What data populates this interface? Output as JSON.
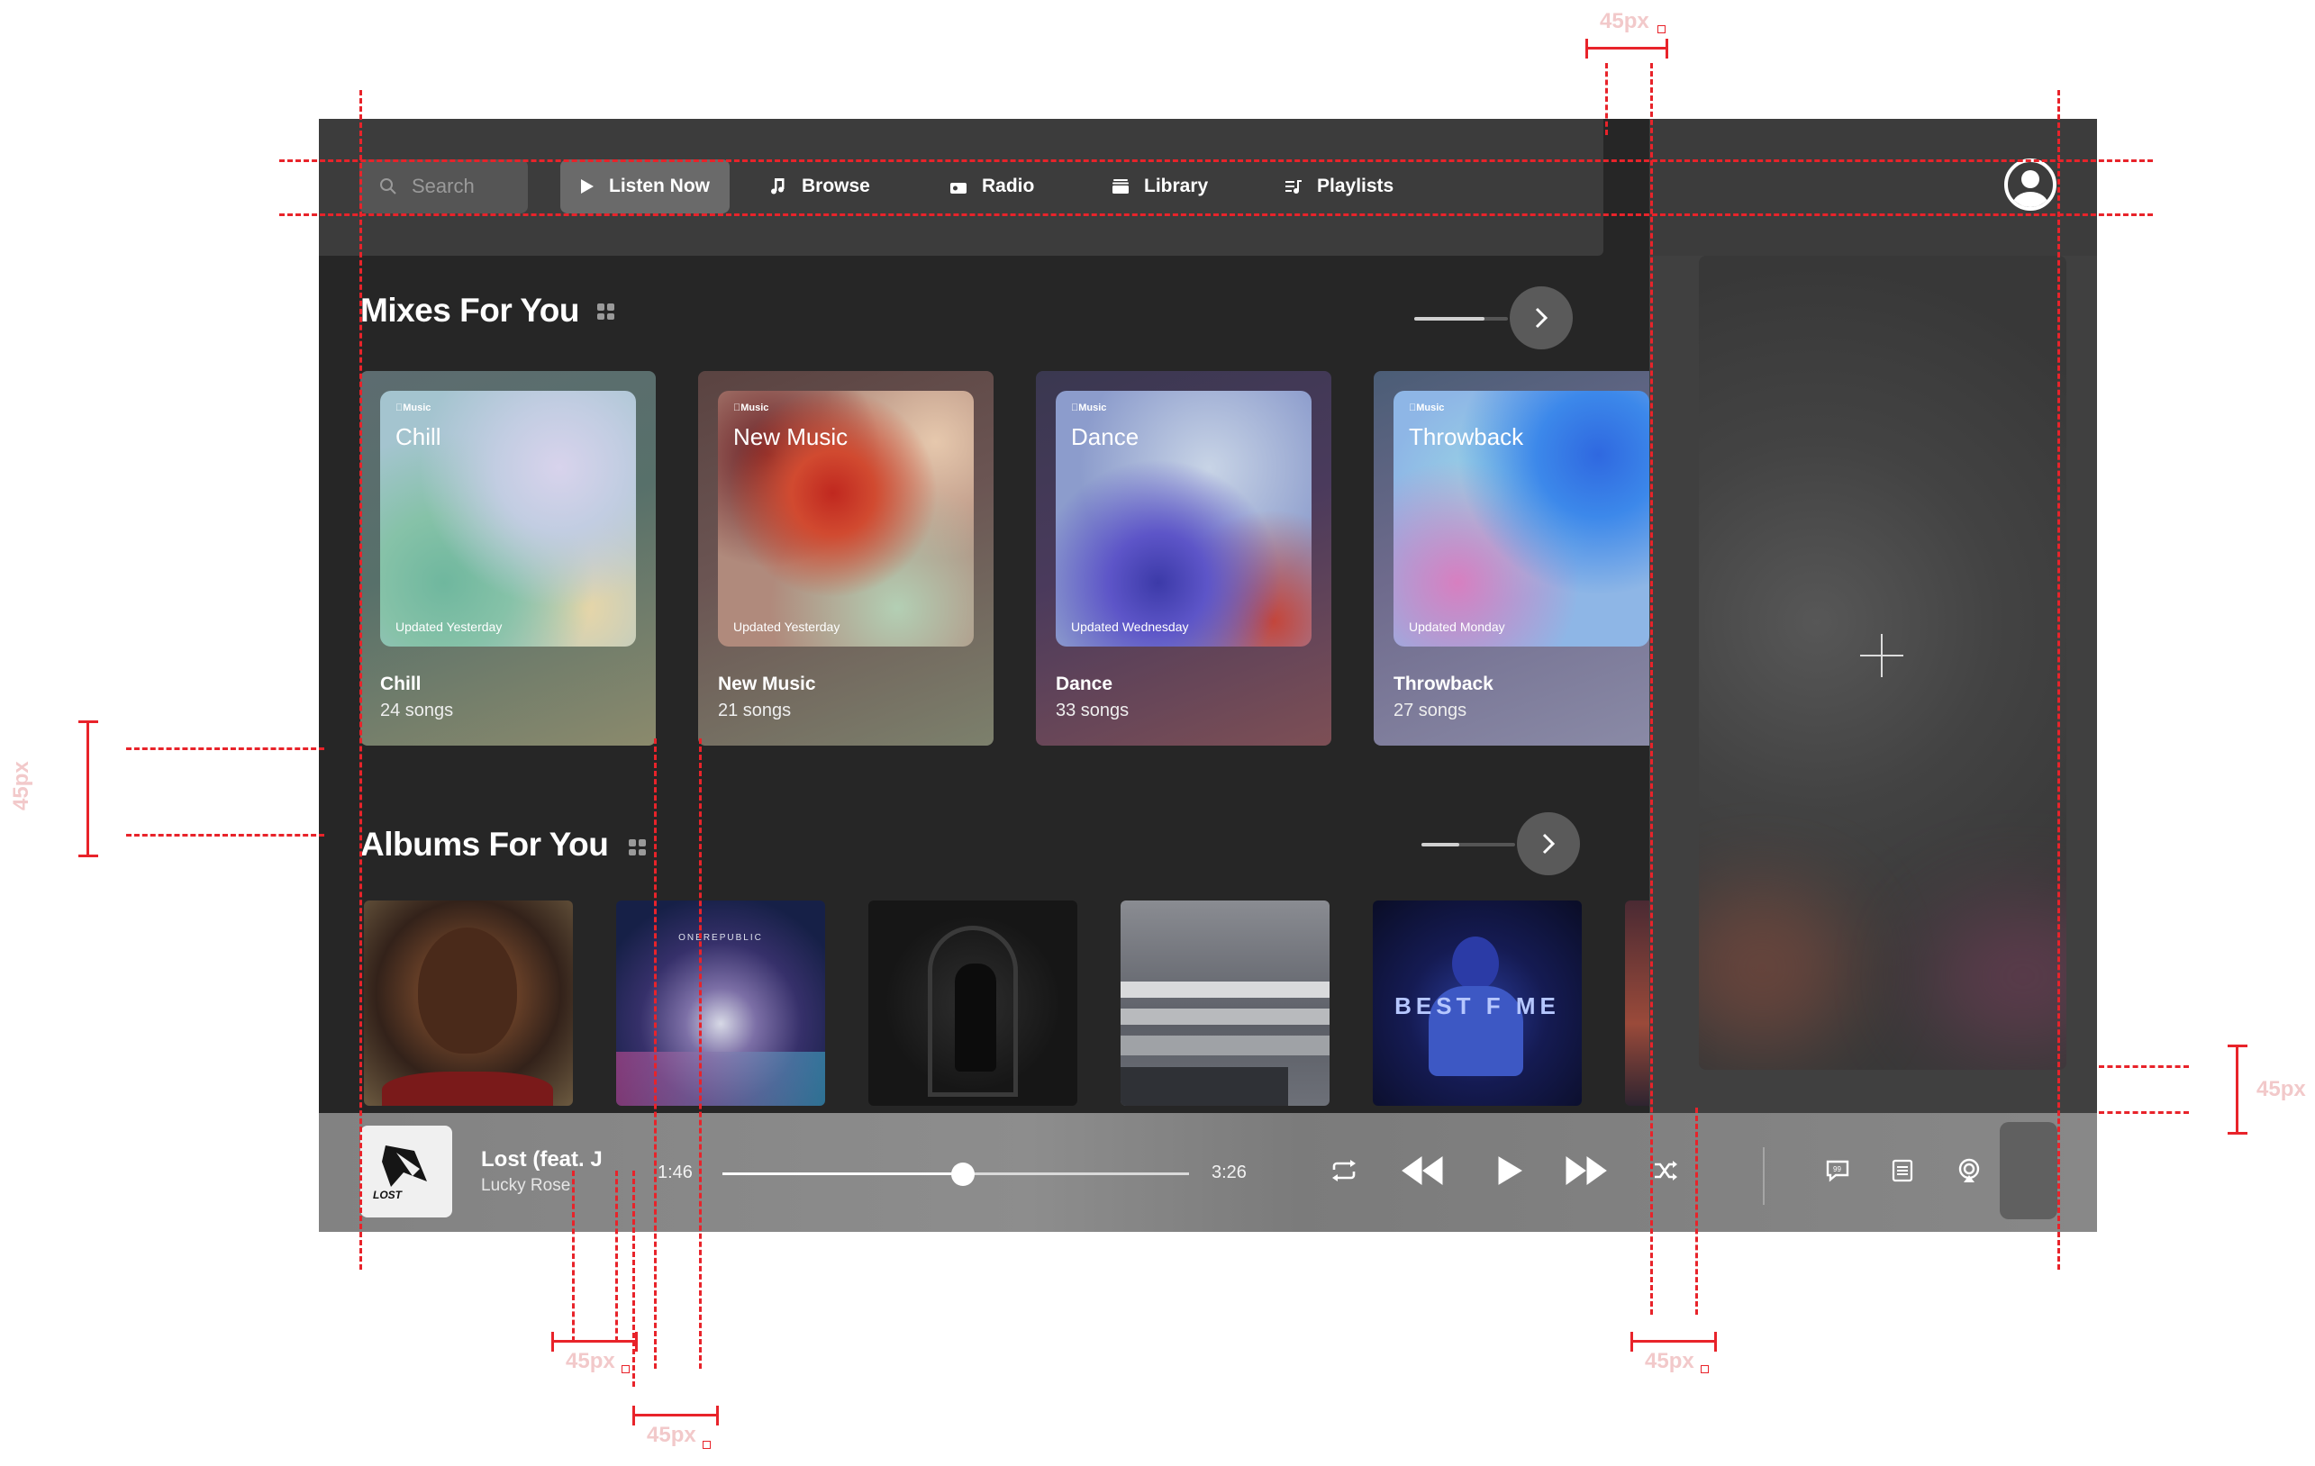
{
  "measurements": {
    "spacing_label": "45px"
  },
  "topbar": {
    "search": {
      "placeholder": "Search",
      "icon": "search-icon"
    },
    "nav": [
      {
        "label": "Listen Now",
        "icon": "play-icon",
        "active": true
      },
      {
        "label": "Browse",
        "icon": "music-note-icon",
        "active": false
      },
      {
        "label": "Radio",
        "icon": "radio-icon",
        "active": false
      },
      {
        "label": "Library",
        "icon": "library-icon",
        "active": false
      },
      {
        "label": "Playlists",
        "icon": "playlists-icon",
        "active": false
      }
    ],
    "profile_icon": "user-avatar-icon"
  },
  "mixes": {
    "title": "Mixes For You",
    "progress": 0.75,
    "cards": [
      {
        "brand": "Music",
        "art_title": "Chill",
        "updated": "Updated Yesterday",
        "name": "Chill",
        "count": "24 songs"
      },
      {
        "brand": "Music",
        "art_title": "New Music",
        "updated": "Updated Yesterday",
        "name": "New Music",
        "count": "21 songs"
      },
      {
        "brand": "Music",
        "art_title": "Dance",
        "updated": "Updated Wednesday",
        "name": "Dance",
        "count": "33 songs"
      },
      {
        "brand": "Music",
        "art_title": "Throwback",
        "updated": "Updated Monday",
        "name": "Throwback",
        "count": "27 songs"
      }
    ]
  },
  "albums": {
    "title": "Albums For You",
    "progress": 0.4,
    "covers": [
      {
        "id": "album-1",
        "text": ""
      },
      {
        "id": "album-2",
        "text": "ONEREPUBLIC"
      },
      {
        "id": "album-3",
        "text": ""
      },
      {
        "id": "album-4",
        "text": ""
      },
      {
        "id": "album-5",
        "text": "BEST  F ME"
      }
    ]
  },
  "player": {
    "title": "Lost (feat. J",
    "artist": "Lucky Rose",
    "elapsed": "1:46",
    "duration": "3:26",
    "progress": 0.515,
    "art_text": "LOST"
  },
  "colors": {
    "accent_guide": "#e8232a",
    "app_bg": "#262626",
    "topbar_bg": "#3c3c3c"
  }
}
